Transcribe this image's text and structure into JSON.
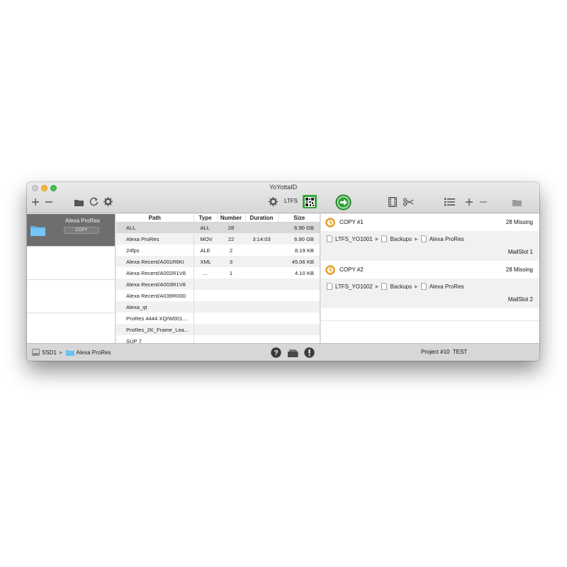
{
  "window": {
    "title": "YoYottaID"
  },
  "toolbar": {
    "ltfs_label": "LTFS",
    "icons": [
      "plus-icon",
      "minus-icon",
      "folder-icon",
      "refresh-icon",
      "gear-icon",
      "gear-icon",
      "qr-code-icon",
      "go-arrow-icon",
      "film-icon",
      "scissors-icon",
      "list-icon",
      "plus-icon",
      "minus-icon",
      "folder-icon"
    ],
    "accent_green": "#2fa33a"
  },
  "sources": {
    "selected": {
      "name": "Alexa ProRes",
      "badge": "COPY"
    }
  },
  "files": {
    "headers": {
      "path": "Path",
      "type": "Type",
      "number": "Number",
      "duration": "Duration",
      "size": "Size"
    },
    "rows": [
      {
        "path": "ALL",
        "type": "ALL",
        "number": "28",
        "duration": "",
        "size": "6.90 GB"
      },
      {
        "path": "Alexa ProRes",
        "type": "MOV",
        "number": "22",
        "duration": "3:14:03",
        "size": "6.90 GB"
      },
      {
        "path": "24fps",
        "type": "ALE",
        "number": "2",
        "duration": "",
        "size": "8.19 KB"
      },
      {
        "path": "Alexa Recent/A001R6KI",
        "type": "XML",
        "number": "3",
        "duration": "",
        "size": "45.06 KB"
      },
      {
        "path": "Alexa Recent/A002R1V8",
        "type": "...",
        "number": "1",
        "duration": "",
        "size": "4.10 KB"
      },
      {
        "path": "Alexa Recent/A003R1V8",
        "type": "",
        "number": "",
        "duration": "",
        "size": ""
      },
      {
        "path": "Alexa Recent/A039R00D",
        "type": "",
        "number": "",
        "duration": "",
        "size": ""
      },
      {
        "path": "Alexa_qt",
        "type": "",
        "number": "",
        "duration": "",
        "size": ""
      },
      {
        "path": "ProRes 4444 XQ/W001...",
        "type": "",
        "number": "",
        "duration": "",
        "size": ""
      },
      {
        "path": "ProRes_2K_Frame_Lea...",
        "type": "",
        "number": "",
        "duration": "",
        "size": ""
      },
      {
        "path": "SUP 7",
        "type": "",
        "number": "",
        "duration": "",
        "size": ""
      }
    ]
  },
  "destinations": [
    {
      "name": "COPY #1",
      "missing": "28 Missing",
      "crumbs": [
        "LTFS_YO1001",
        "Backups",
        "Alexa ProRes"
      ],
      "slot": "MailSlot 1"
    },
    {
      "name": "COPY #2",
      "missing": "28 Missing",
      "crumbs": [
        "LTFS_YO1002",
        "Backups",
        "Alexa ProRes"
      ],
      "slot": "MailSlot 2"
    }
  ],
  "statusbar": {
    "crumbs": [
      "SSD1",
      "Alexa ProRes"
    ],
    "project": "Project #10  TEST",
    "icons": [
      "help-icon",
      "disk-icon",
      "alert-icon"
    ]
  }
}
